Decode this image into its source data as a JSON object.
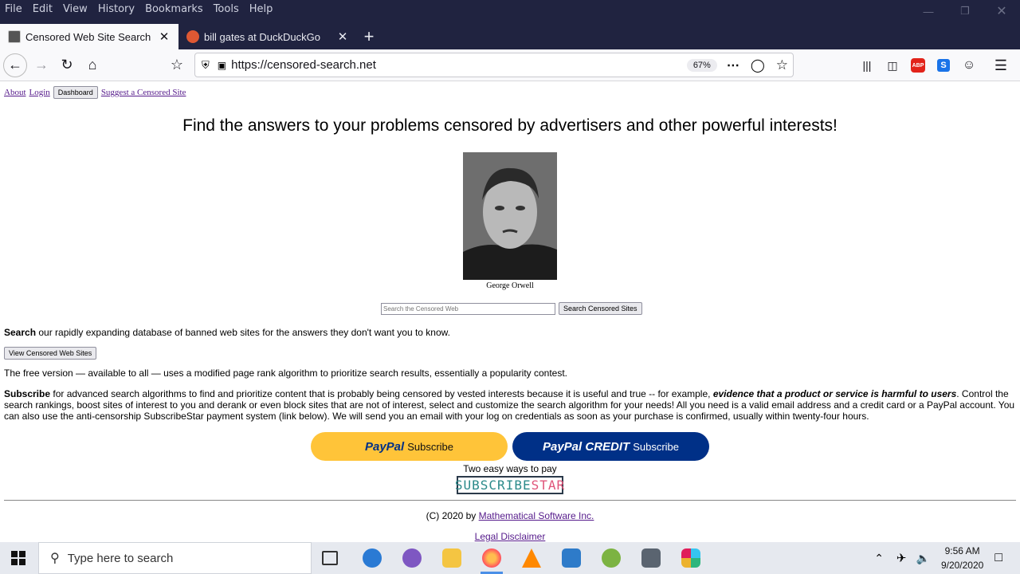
{
  "menu": [
    "File",
    "Edit",
    "View",
    "History",
    "Bookmarks",
    "Tools",
    "Help"
  ],
  "tabs": [
    {
      "label": "Censored Web Site Search",
      "active": true
    },
    {
      "label": "bill gates at DuckDuckGo",
      "active": false
    }
  ],
  "url": "https://censored-search.net",
  "zoom": "67%",
  "toplinks": {
    "about": "About",
    "login": "Login",
    "dashboard": "Dashboard",
    "suggest": "Suggest a Censored Site"
  },
  "headline": "Find the answers to your problems censored by advertisers and other powerful interests!",
  "portrait_caption": "George Orwell",
  "search": {
    "placeholder": "Search the Censored Web",
    "button": "Search Censored Sites"
  },
  "search_para": {
    "bold": "Search",
    "text": " our rapidly expanding database of banned web sites for the answers they don't want you to know."
  },
  "view_button": "View Censored Web Sites",
  "free_para": "The free version — available to all — uses a modified page rank algorithm to prioritize search results, essentially a popularity contest.",
  "subscribe_para": {
    "bold": "Subscribe",
    "text1": " for advanced search algorithms to find and prioritize content that is probably being censored by vested interests because it is useful and true -- for example, ",
    "emph": "evidence that a product or service is harmful to users",
    "text2": ". Control the search rankings, boost sites of interest to you and derank or even block sites that are not of interest, select and customize the search algorithm for your needs! All you need is a valid email address and a credit card or a PayPal account. You can also use the anti-censorship SubscribeStar payment system (link below). We will send you an email with your log on credentials as soon as your purchase is confirmed, usually within twenty-four hours."
  },
  "paypal": {
    "brand": "PayPal",
    "label": "Subscribe"
  },
  "paypal_credit": {
    "brand": "PayPal CREDIT",
    "label": "Subscribe"
  },
  "ways": "Two easy ways to pay",
  "subscribestar": {
    "part1": "SUBSCRIBE",
    "part2": "STAR"
  },
  "footer": {
    "copyright": "(C) 2020 by ",
    "company": "Mathematical Software Inc.",
    "legal": "Legal Disclaimer"
  },
  "taskbar": {
    "search_placeholder": "Type here to search",
    "time": "9:56 AM",
    "date": "9/20/2020"
  },
  "colors": {
    "titlebar": "#202340",
    "paypal_yellow": "#ffc439",
    "paypal_blue": "#003087",
    "link": "#551a8b"
  }
}
